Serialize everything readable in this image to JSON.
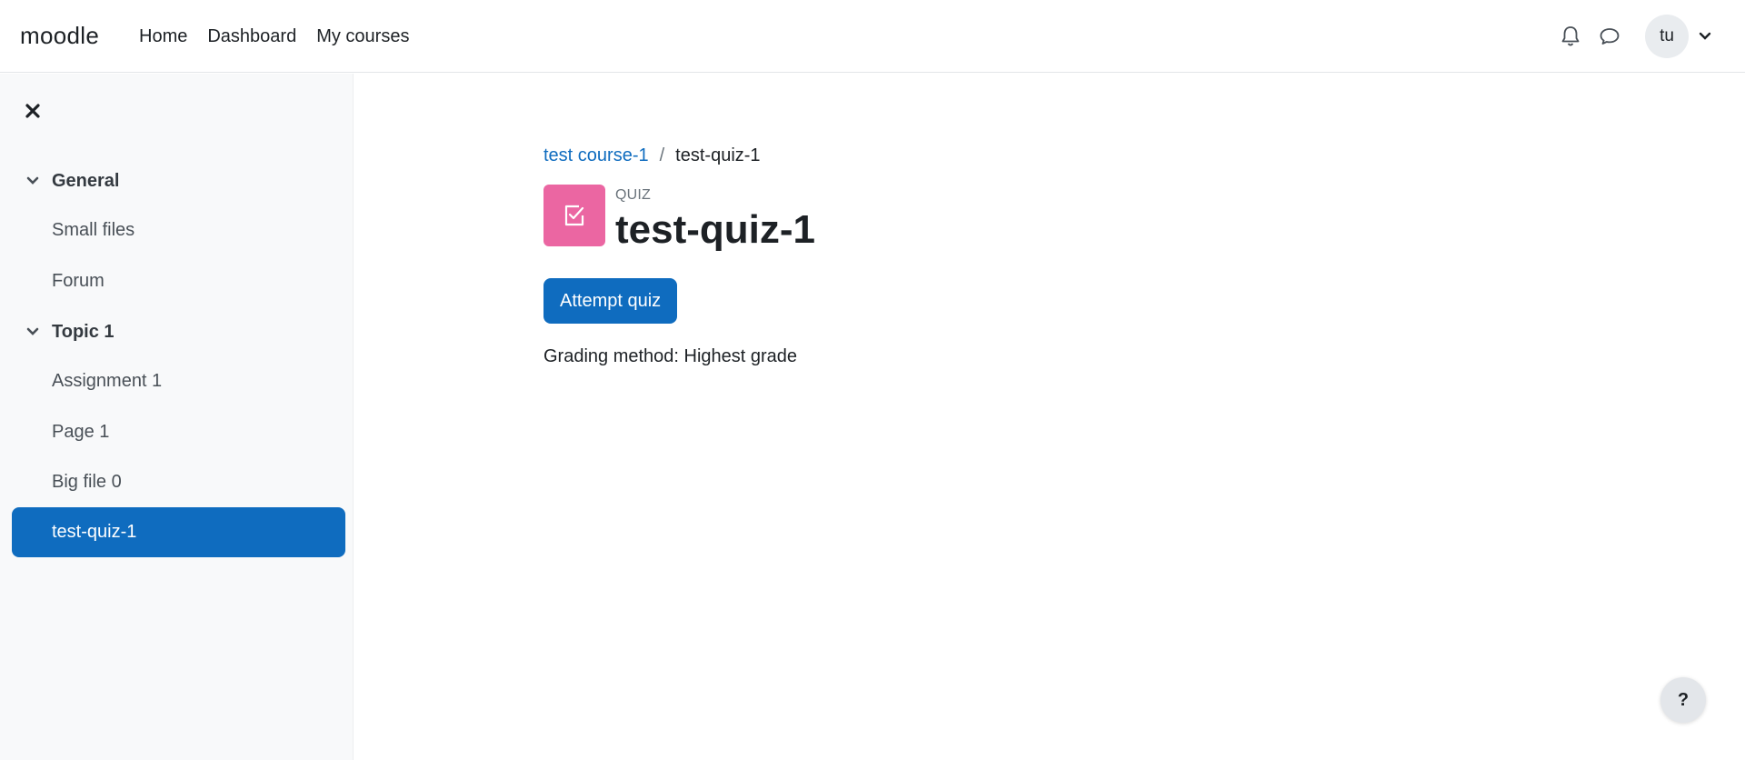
{
  "brand": "moodle",
  "nav": {
    "items": [
      "Home",
      "Dashboard",
      "My courses"
    ]
  },
  "user": {
    "initials": "tu"
  },
  "icons": {
    "notifications": "bell-icon",
    "messages": "chat-bubble-icon",
    "user_menu": "chevron-down-icon",
    "close_drawer": "close-icon",
    "section_toggle": "chevron-down-icon",
    "activity": "quiz-checkbox-icon"
  },
  "course_index": {
    "sections": [
      {
        "title": "General",
        "items": [
          "Small files",
          "Forum"
        ]
      },
      {
        "title": "Topic 1",
        "items": [
          "Assignment 1",
          "Page 1",
          "Big file 0",
          "test-quiz-1"
        ]
      }
    ],
    "active_item": "test-quiz-1"
  },
  "breadcrumb": {
    "course": "test course-1",
    "separator": "/",
    "current": "test-quiz-1"
  },
  "activity": {
    "purpose": "QUIZ",
    "title": "test-quiz-1",
    "icon_color": "#eb66a2"
  },
  "actions": {
    "attempt_label": "Attempt quiz"
  },
  "info": {
    "grading": "Grading method: Highest grade"
  },
  "help": {
    "label": "?"
  },
  "colors": {
    "primary": "#0f6cbf",
    "drawer_bg": "#f8f9fa"
  }
}
